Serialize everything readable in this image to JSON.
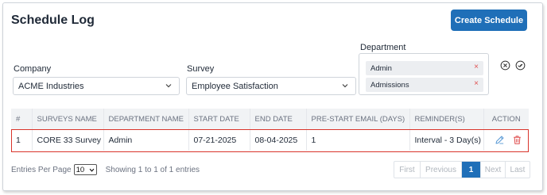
{
  "page": {
    "title": "Schedule Log",
    "create_button_label": "Create Schedule"
  },
  "filters": {
    "company": {
      "label": "Company",
      "value": "ACME Industries"
    },
    "survey": {
      "label": "Survey",
      "value": "Employee Satisfaction"
    },
    "department": {
      "label": "Department",
      "chips": [
        {
          "label": "Admin",
          "remove": "×"
        },
        {
          "label": "Admissions",
          "remove": "×"
        }
      ]
    }
  },
  "table": {
    "headers": [
      "#",
      "SURVEYS NAME",
      "DEPARTMENT NAME",
      "START DATE",
      "END DATE",
      "PRE-START EMAIL (DAYS)",
      "REMINDER(S)",
      "ACTION"
    ],
    "rows": [
      {
        "num": "1",
        "survey": "CORE 33 Survey",
        "department": "Admin",
        "start": "07-21-2025",
        "end": "08-04-2025",
        "prestart": "1",
        "reminder": "Interval - 3 Day(s)"
      }
    ]
  },
  "footer": {
    "entries_label": "Entries Per Page",
    "per_page": "10",
    "showing": "Showing 1 to 1 of 1 entries"
  },
  "pagination": {
    "first": "First",
    "previous": "Previous",
    "current": "1",
    "next": "Next",
    "last": "Last"
  },
  "colors": {
    "primary": "#1f6fb8",
    "highlight_outline": "#d9342b",
    "chip_remove": "#e05252",
    "edit_icon": "#5b9bd5",
    "delete_icon": "#e05252"
  }
}
